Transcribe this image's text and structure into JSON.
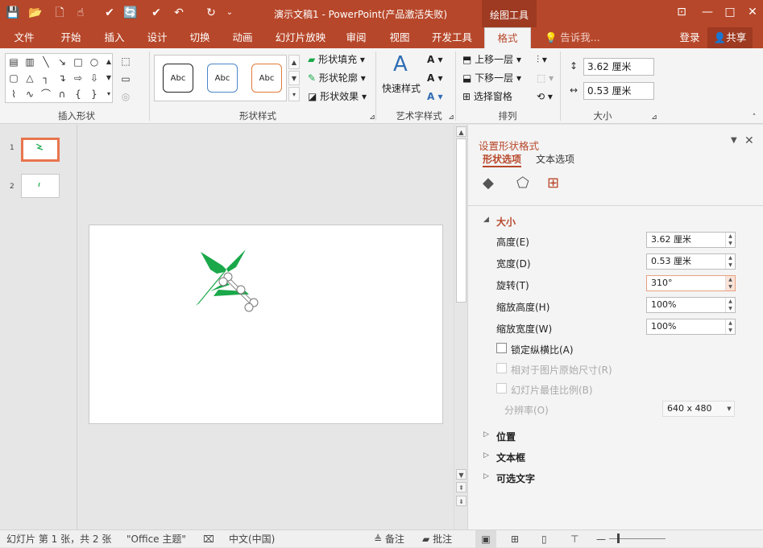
{
  "window": {
    "title": "演示文稿1 - PowerPoint(产品激活失败)",
    "context_tab": "绘图工具",
    "controls": {
      "restore": "⊡",
      "minimize": "—",
      "maximize": "□",
      "close": "✕"
    }
  },
  "quick_access": {
    "save_icon": "💾",
    "open_icon": "📂",
    "new_icon": "🗋",
    "touch_icon": "☝",
    "check_icon": "✔",
    "comment_icon": "🔄",
    "undo_icon": "↶",
    "redo_icon": "↻",
    "more_icon": "⌄"
  },
  "tabs": [
    {
      "label": "文件"
    },
    {
      "label": "开始"
    },
    {
      "label": "插入"
    },
    {
      "label": "设计"
    },
    {
      "label": "切换"
    },
    {
      "label": "动画"
    },
    {
      "label": "幻灯片放映"
    },
    {
      "label": "审阅"
    },
    {
      "label": "视图"
    },
    {
      "label": "开发工具"
    },
    {
      "label": "格式"
    }
  ],
  "tell_me": "告诉我...",
  "login": "登录",
  "share": "共享",
  "ribbon": {
    "insert_shapes_label": "插入形状",
    "shape_styles_label": "形状样式",
    "wordart_label": "艺术字样式",
    "arrange_label": "排列",
    "size_label": "大小",
    "style_sample": "Abc",
    "shape_fill": "形状填充",
    "shape_outline": "形状轮廓",
    "shape_effects": "形状效果",
    "quick_styles": "快速样式",
    "bring_forward": "上移一层",
    "send_backward": "下移一层",
    "selection_pane": "选择窗格",
    "height_value": "3.62 厘米",
    "width_value": "0.53 厘米"
  },
  "slides": [
    {
      "num": "1"
    },
    {
      "num": "2"
    }
  ],
  "panel": {
    "title": "设置形状格式",
    "tab_shape": "形状选项",
    "tab_text": "文本选项",
    "size_section": "大小",
    "height_label": "高度(E)",
    "height_value": "3.62 厘米",
    "width_label": "宽度(D)",
    "width_value": "0.53 厘米",
    "rotation_label": "旋转(T)",
    "rotation_value": "310°",
    "scale_h_label": "缩放高度(H)",
    "scale_h_value": "100%",
    "scale_w_label": "缩放宽度(W)",
    "scale_w_value": "100%",
    "lock_ratio": "锁定纵横比(A)",
    "relative_original": "相对于图片原始尺寸(R)",
    "best_scale": "幻灯片最佳比例(B)",
    "resolution_label": "分辨率(O)",
    "resolution_value": "640 x 480",
    "position_section": "位置",
    "textbox_section": "文本框",
    "alt_text_section": "可选文字"
  },
  "status": {
    "slide_info": "幻灯片 第 1 张，共 2 张",
    "theme": "\"Office 主题\"",
    "language": "中文(中国)",
    "notes": "备注",
    "comments": "批注"
  },
  "colors": {
    "accent": "#b7472a",
    "shape_green": "#1aa84a"
  }
}
